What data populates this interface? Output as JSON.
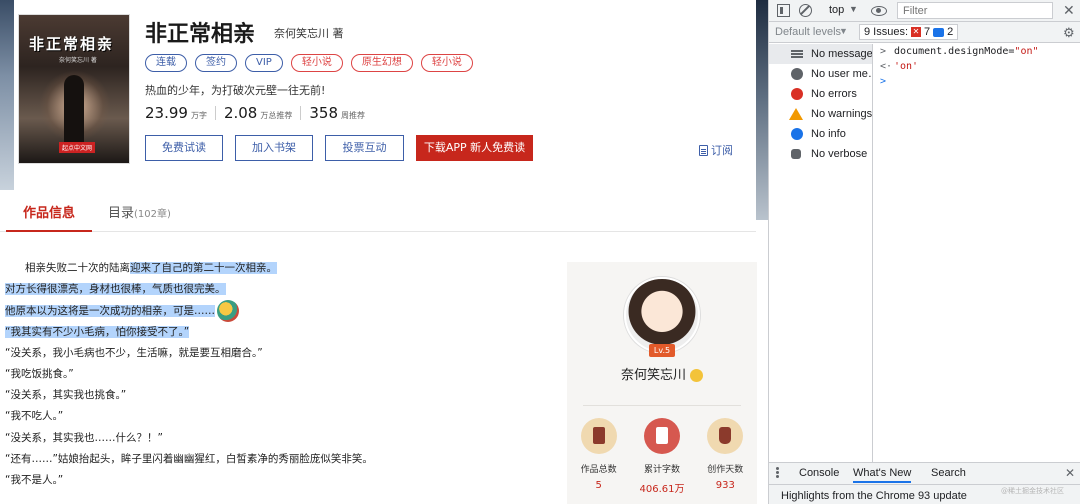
{
  "book": {
    "title": "非正常相亲",
    "author_line": "奈何笑忘川 著",
    "cover_title": "非正常相亲",
    "cover_author": "奈何笑忘川 著",
    "cover_publisher": "起点中文网",
    "tags": [
      {
        "label": "连载",
        "tone": "blue"
      },
      {
        "label": "签约",
        "tone": "blue"
      },
      {
        "label": "VIP",
        "tone": "blue"
      },
      {
        "label": "轻小说",
        "tone": "red"
      },
      {
        "label": "原生幻想",
        "tone": "red"
      },
      {
        "label": "轻小说",
        "tone": "red"
      }
    ],
    "slogan": "热血的少年，为打破次元壁一往无前!",
    "stats": [
      {
        "value": "23.99",
        "unit": "万字"
      },
      {
        "value": "2.08",
        "unit": "万总推荐"
      },
      {
        "value": "358",
        "unit": "周推荐"
      }
    ]
  },
  "actions": {
    "trial": "免费试读",
    "shelf": "加入书架",
    "vote": "投票互动",
    "app": "下载APP 新人免费读",
    "subscribe": "订阅"
  },
  "tabs": {
    "info": "作品信息",
    "toc": "目录",
    "toc_count": "(102章)"
  },
  "content": {
    "lines": [
      {
        "lead": "      相亲失败二十次的陆离",
        "hl": "迎来了自己的第二十一次相亲。"
      },
      {
        "lead": "",
        "hl": "对方长得很漂亮，身材也很棒，气质也很完美。"
      },
      {
        "lead": "",
        "hl": "他原本以为这将是一次成功的相亲，可是……"
      },
      {
        "lead": "",
        "hl": "“我其实有不少小毛病，怕你接受不了。”"
      },
      {
        "lead": "“没关系，我小毛病也不少，生活嘛，就是要互相磨合。”",
        "hl": ""
      },
      {
        "lead": "“我吃饭挑食。”",
        "hl": ""
      },
      {
        "lead": "“没关系，其实我也挑食。”",
        "hl": ""
      },
      {
        "lead": "“我不吃人。”",
        "hl": ""
      },
      {
        "lead": "“没关系，其实我也……什么？！”",
        "hl": ""
      },
      {
        "lead": "“还有……”姑娘抬起头，眸子里闪着幽幽猩红，白皙素净的秀丽脸庞似笑非笑。",
        "hl": ""
      },
      {
        "lead": "“我不是人。”",
        "hl": ""
      }
    ]
  },
  "author_card": {
    "name": "奈何笑忘川",
    "level": "Lv.5",
    "stats": [
      {
        "label": "作品总数",
        "value": "5",
        "icon": "books-icon"
      },
      {
        "label": "累计字数",
        "value": "406.61万",
        "icon": "words-icon"
      },
      {
        "label": "创作天数",
        "value": "933",
        "icon": "days-icon"
      }
    ]
  },
  "devtools": {
    "context": "top",
    "filter_placeholder": "Filter",
    "levels": "Default levels",
    "issues_label": "9 Issues:",
    "issues_errors": "7",
    "issues_info": "2",
    "sidebar": [
      "No messages",
      "No user me…",
      "No errors",
      "No warnings",
      "No info",
      "No verbose"
    ],
    "console": {
      "input_ident": "document.designMode=",
      "input_str": "\"on\"",
      "output": "'on'"
    },
    "drawer_tabs": [
      "Console",
      "What's New",
      "Search"
    ],
    "drawer_body": "Highlights from the Chrome 93 update"
  },
  "watermark": "@稀土掘金技术社区"
}
